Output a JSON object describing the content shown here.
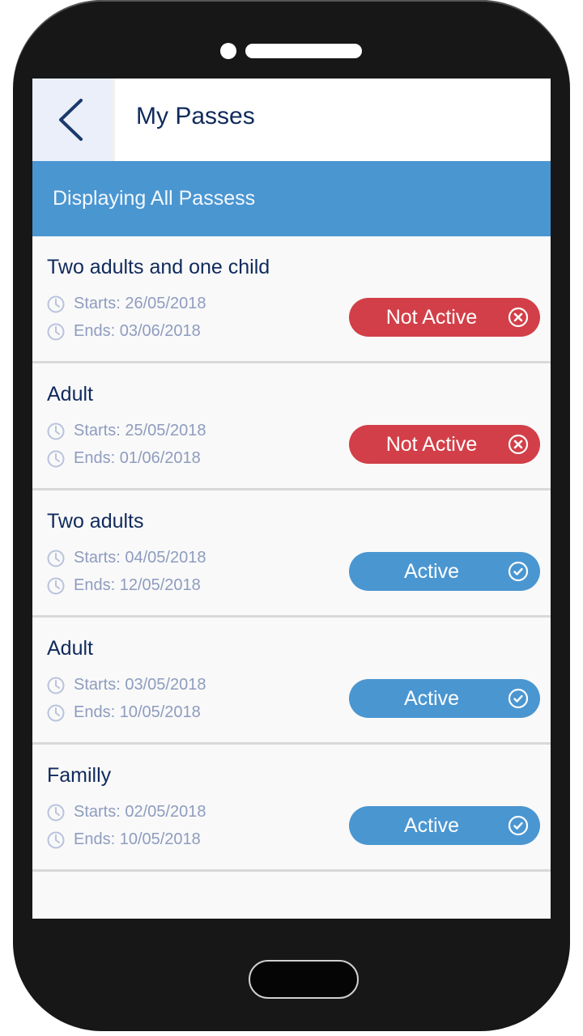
{
  "header": {
    "title": "My Passes",
    "back_icon": "chevron-left-icon"
  },
  "banner": {
    "text": "Displaying All Passess"
  },
  "colors": {
    "primary": "#4a96d1",
    "inactive": "#d23f48",
    "title_text": "#102a5c",
    "meta_text": "#8e9cbf"
  },
  "passes": [
    {
      "name": "Two adults and one child",
      "start": "Starts: 26/05/2018",
      "end": "Ends: 03/06/2018",
      "status": "Not Active",
      "status_type": "inactive",
      "status_icon": "x-circle-icon"
    },
    {
      "name": "Adult",
      "start": "Starts: 25/05/2018",
      "end": "Ends: 01/06/2018",
      "status": "Not Active",
      "status_type": "inactive",
      "status_icon": "x-circle-icon"
    },
    {
      "name": "Two adults",
      "start": "Starts: 04/05/2018",
      "end": "Ends: 12/05/2018",
      "status": "Active",
      "status_type": "active",
      "status_icon": "check-circle-icon"
    },
    {
      "name": "Adult",
      "start": "Starts: 03/05/2018",
      "end": "Ends: 10/05/2018",
      "status": "Active",
      "status_type": "active",
      "status_icon": "check-circle-icon"
    },
    {
      "name": "Familly",
      "start": "Starts: 02/05/2018",
      "end": "Ends: 10/05/2018",
      "status": "Active",
      "status_type": "active",
      "status_icon": "check-circle-icon"
    }
  ]
}
